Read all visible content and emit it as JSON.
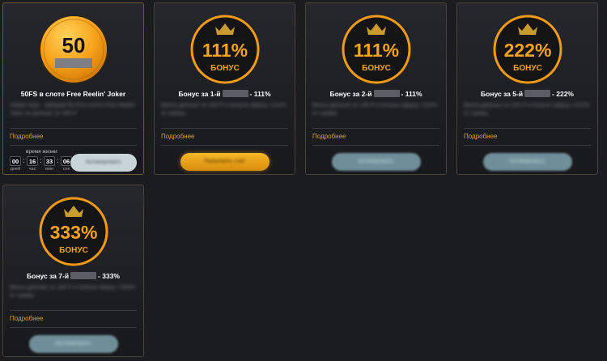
{
  "colors": {
    "accent_gold": "#d4a237",
    "badge_orange": "#f7a21b",
    "badge_black": "#141414",
    "button_gold": "#f7b826",
    "button_teal": "#6f8f98"
  },
  "cards": [
    {
      "badge_top": "50",
      "badge_bottom": "",
      "title_before": "50FS в слоте Free Reelin' Joker",
      "title_after": "",
      "has_mask": false,
      "description": "Новая игра - забирай 50 FS в слоте Free Reelin' Joker за депозит от 300 Р",
      "more_label": "Подробнее",
      "button_label": "Активировать",
      "timer": {
        "label": "время жизни",
        "days": "00",
        "hours": "16",
        "minutes": "33",
        "seconds": "06",
        "days_unit": "дней",
        "hours_unit": "час",
        "minutes_unit": "мин",
        "seconds_unit": "сек"
      }
    },
    {
      "badge_top": "111%",
      "badge_bottom": "БОНУС",
      "title_before": "Бонус за 1-й",
      "title_after": "- 111%",
      "has_mask": true,
      "description": "Внеси депозит от 100 Р и получи сверху +111% от суммы",
      "more_label": "Подробнее",
      "button_label": "Пополнить счет"
    },
    {
      "badge_top": "111%",
      "badge_bottom": "БОНУС",
      "title_before": "Бонус за 2-й",
      "title_after": "- 111%",
      "has_mask": true,
      "description": "Внеси депозит от 100 Р и получи сверху +111% от суммы",
      "more_label": "Подробнее",
      "button_label": "Активировать"
    },
    {
      "badge_top": "222%",
      "badge_bottom": "БОНУС",
      "title_before": "Бонус за 5-й",
      "title_after": "- 222%",
      "has_mask": true,
      "description": "Внеси депозит от 100 Р и получи сверху +222% от суммы",
      "more_label": "Подробнее",
      "button_label": "Активировать"
    },
    {
      "badge_top": "333%",
      "badge_bottom": "БОНУС",
      "title_before": "Бонус за 7-й",
      "title_after": "- 333%",
      "has_mask": true,
      "description": "Внеси депозит от 100 Р и получи сверху +333% от суммы",
      "more_label": "Подробнее",
      "button_label": "Активировать"
    }
  ]
}
